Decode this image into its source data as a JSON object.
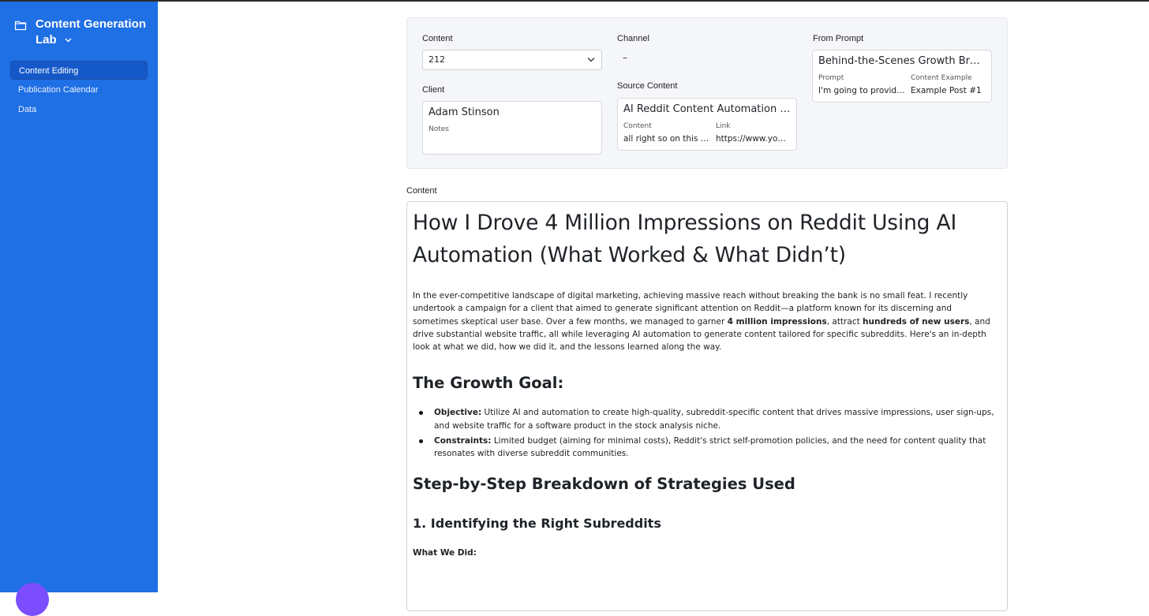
{
  "sidebar": {
    "brand": "Content Generation Lab",
    "items": [
      {
        "label": "Content Editing",
        "active": true
      },
      {
        "label": "Publication Calendar",
        "active": false
      },
      {
        "label": "Data",
        "active": false
      }
    ]
  },
  "form": {
    "content_label": "Content",
    "content_value": "212",
    "channel_label": "Channel",
    "channel_value": "–",
    "from_prompt_label": "From Prompt",
    "client_label": "Client",
    "client_name": "Adam Stinson",
    "client_notes_label": "Notes",
    "source_label": "Source Content",
    "source_title": "AI Reddit Content Automation Campaign",
    "source_content_label": "Content",
    "source_content_value": "all right so on this video I'm going to",
    "source_link_label": "Link",
    "source_link_value": "https://www.youtube.com",
    "prompt_title": "Behind-the-Scenes Growth Breakdown",
    "prompt_prompt_label": "Prompt",
    "prompt_prompt_value": "I'm going to provide you with",
    "prompt_example_label": "Content Example",
    "prompt_example_value": "Example Post #1"
  },
  "editor": {
    "label": "Content",
    "title": "How I Drove 4 Million Impressions on Reddit Using AI Automation (What Worked & What Didn’t)",
    "intro_part1": "In the ever-competitive landscape of digital marketing, achieving massive reach without breaking the bank is no small feat. I recently undertook a campaign for a client that aimed to generate significant attention on Reddit—a platform known for its discerning and sometimes skeptical user base. Over a few months, we managed to garner ",
    "intro_bold1": "4 million impressions",
    "intro_part2": ", attract ",
    "intro_bold2": "hundreds of new users",
    "intro_part3": ", and drive substantial website traffic, all while leveraging AI automation to generate content tailored for specific subreddits. Here's an in-depth look at what we did, how we did it, and the lessons learned along the way.",
    "h_growth": "The Growth Goal:",
    "bullets": [
      {
        "label": "Objective:",
        "text": " Utilize AI and automation to create high-quality, subreddit-specific content that drives massive impressions, user sign-ups, and website traffic for a software product in the stock analysis niche."
      },
      {
        "label": "Constraints:",
        "text": " Limited budget (aiming for minimal costs), Reddit's strict self-promotion policies, and the need for content quality that resonates with diverse subreddit communities."
      }
    ],
    "h_steps": "Step-by-Step Breakdown of Strategies Used",
    "h_step1": "1. Identifying the Right Subreddits",
    "what_we_did": "What We Did:"
  }
}
